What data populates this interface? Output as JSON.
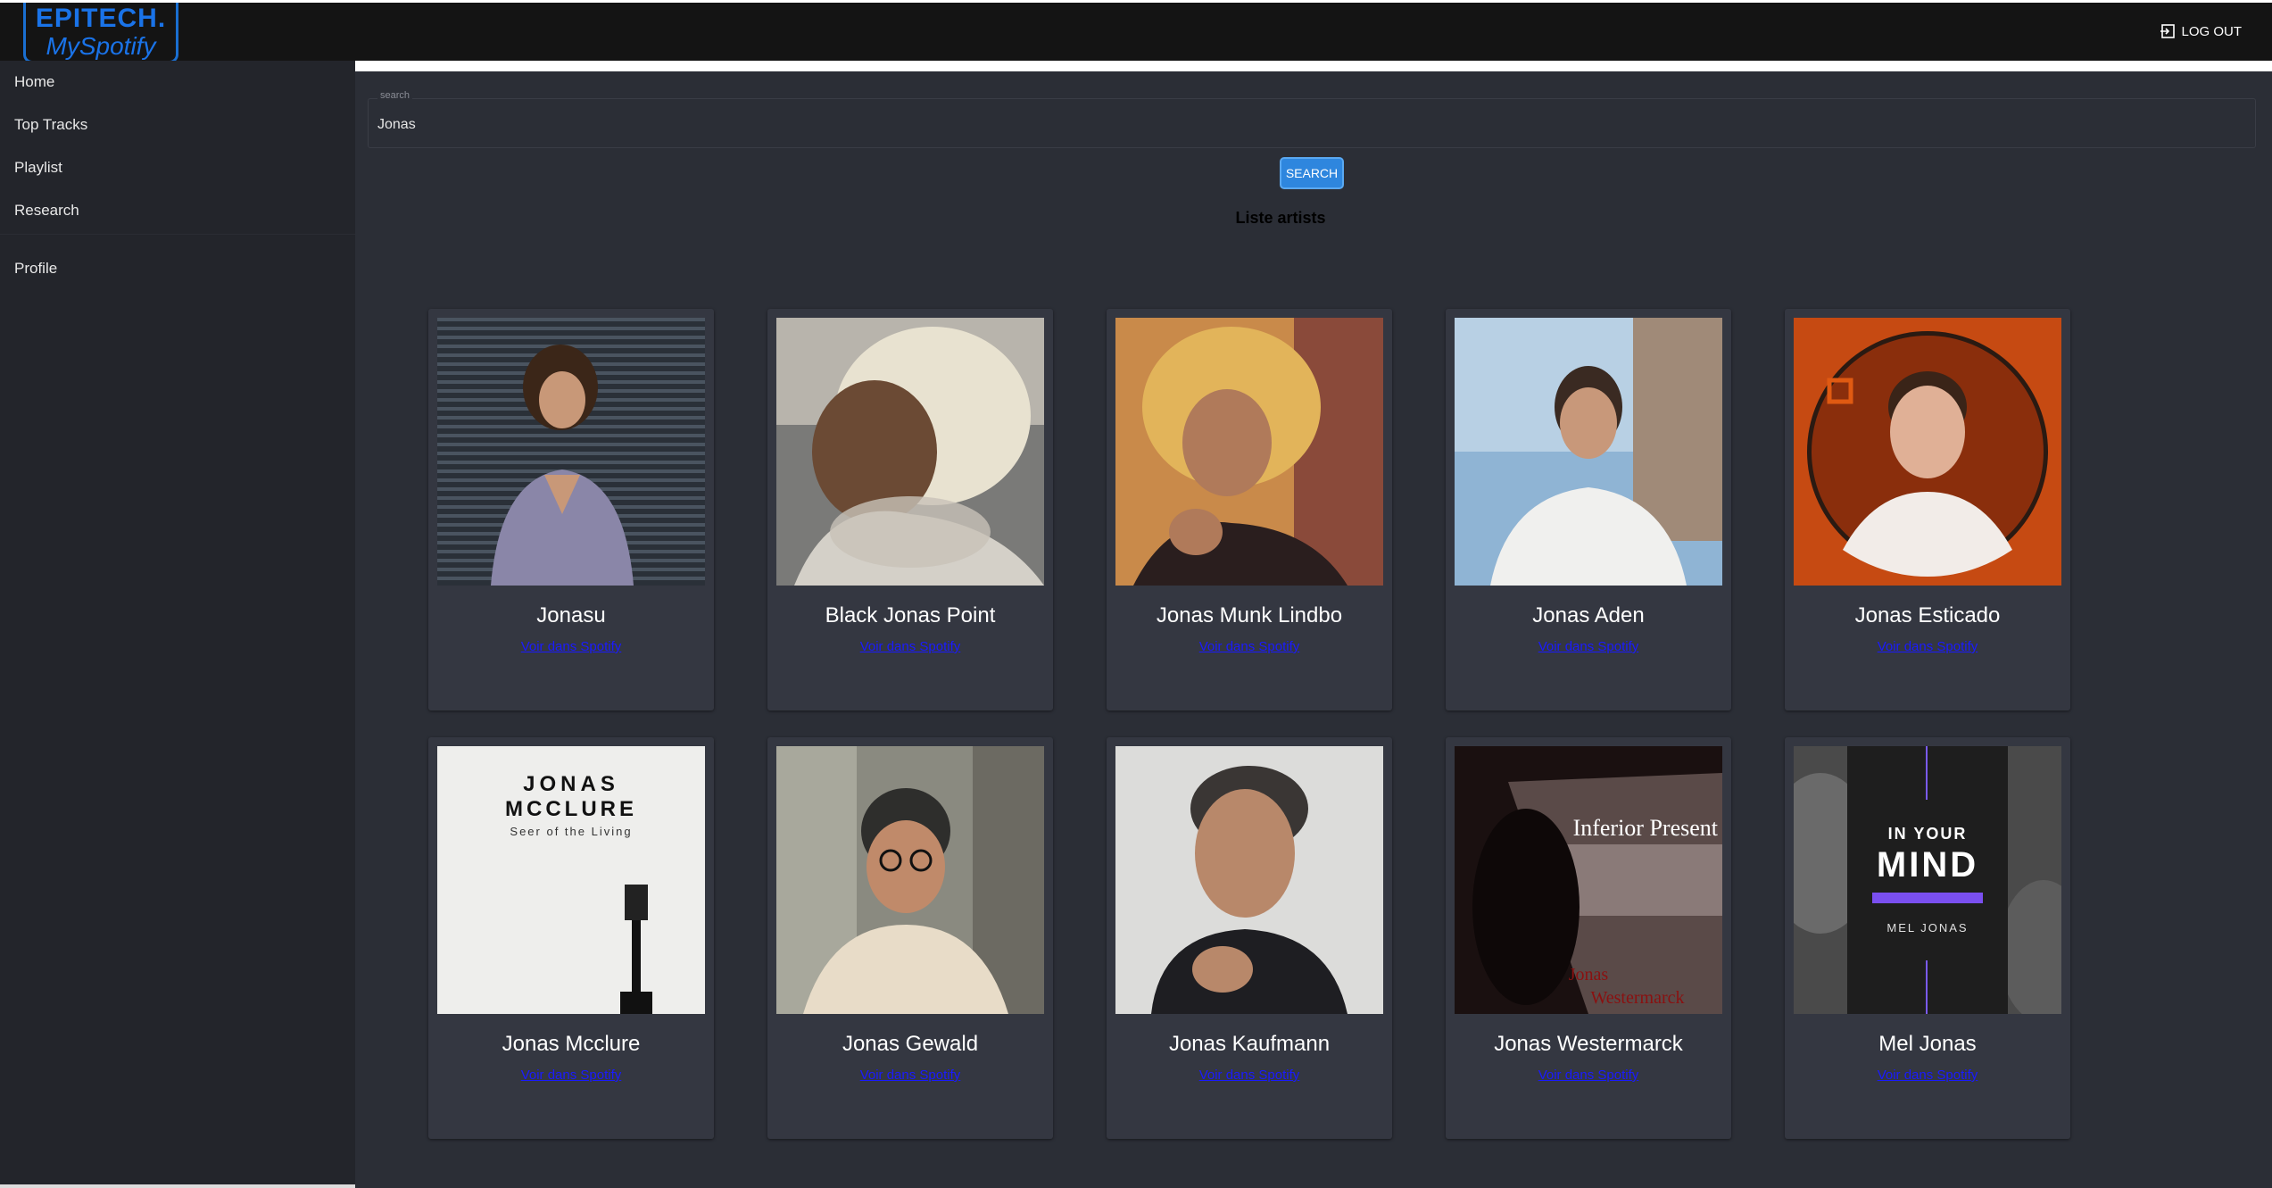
{
  "header": {
    "logo_line1": "EPITECH.",
    "logo_line2": "MySpotify",
    "logout_label": "LOG OUT"
  },
  "sidebar": {
    "items": [
      {
        "label": "Home"
      },
      {
        "label": "Top Tracks"
      },
      {
        "label": "Playlist"
      },
      {
        "label": "Research"
      },
      {
        "label": "Profile"
      }
    ]
  },
  "search": {
    "label": "search",
    "value": "Jonas",
    "button_label": "SEARCH"
  },
  "results": {
    "title": "Liste artists",
    "link_label": "Voir dans Spotify",
    "artists": [
      {
        "name": "Jonasu"
      },
      {
        "name": "Black Jonas Point"
      },
      {
        "name": "Jonas Munk Lindbo"
      },
      {
        "name": "Jonas Aden"
      },
      {
        "name": "Jonas Esticado"
      },
      {
        "name": "Jonas Mcclure"
      },
      {
        "name": "Jonas Gewald"
      },
      {
        "name": "Jonas Kaufmann"
      },
      {
        "name": "Jonas Westermarck"
      },
      {
        "name": "Mel Jonas"
      }
    ]
  },
  "image_text": {
    "mcclure_line1": "JONAS",
    "mcclure_line2": "MCCLURE",
    "mcclure_line3": "Seer of the Living",
    "westermarck_title": "Inferior Present",
    "westermarck_line1": "Jonas",
    "westermarck_line2": "Westermarck",
    "mel_line1": "IN YOUR",
    "mel_line2": "MIND",
    "mel_line3": "MEL JONAS"
  },
  "colors": {
    "accent": "#2e86de",
    "link": "#1a1aff",
    "logo": "#1a73e8"
  }
}
